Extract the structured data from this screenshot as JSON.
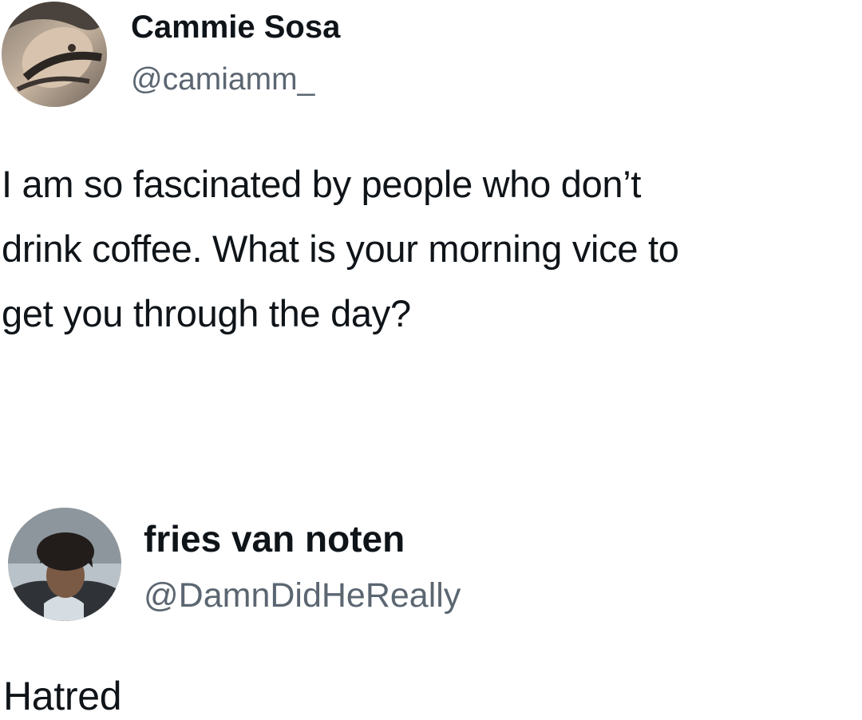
{
  "original_post": {
    "author": {
      "display_name": "Cammie Sosa",
      "handle": "@camiamm_",
      "avatar_icon": "profile-photo"
    },
    "text_lines": [
      "I am so fascinated by people who don’t",
      "drink coffee. What is your morning vice to",
      "get you through the day?"
    ]
  },
  "reply_post": {
    "author": {
      "display_name": "fries van noten",
      "handle": "@DamnDidHeReally",
      "avatar_icon": "profile-photo"
    },
    "text": "Hatred"
  }
}
